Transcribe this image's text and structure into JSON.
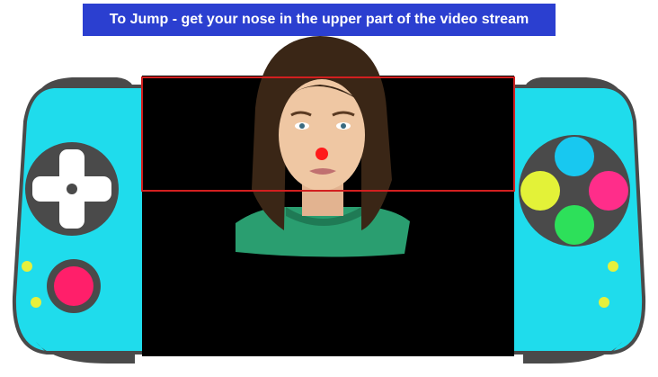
{
  "instruction": {
    "text": "To Jump - get your nose in the upper part of the video stream"
  },
  "colors": {
    "banner_bg": "#2b3fd0",
    "console_body": "#1fdcec",
    "console_outline": "#4a4a4a",
    "screen": "#000000",
    "jump_zone_border": "#d21f1f",
    "nose_marker": "#ff1a1a",
    "button_top": "#18c8f0",
    "button_left": "#e3f238",
    "button_right": "#ff2d8a",
    "button_bottom": "#2de05a",
    "left_action_button": "#ff1f6a",
    "indicator_dots": "#e6f03c"
  },
  "icons": {
    "dpad": "dpad-icon",
    "face_buttons": "face-buttons-icon",
    "action": "action-button-icon"
  }
}
